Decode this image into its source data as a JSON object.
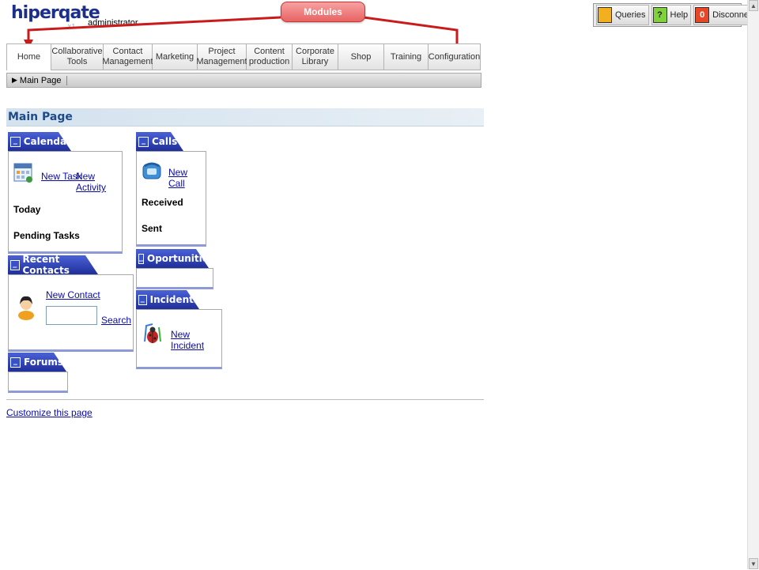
{
  "header": {
    "logo": "hiperqate",
    "logo_sub": "v.1",
    "user": "administrator",
    "callout": "Modules"
  },
  "topbar": [
    {
      "label": "Queries",
      "icon": "queries-icon",
      "color": "#f2b01e",
      "glyph": ""
    },
    {
      "label": "Help",
      "icon": "help-icon",
      "color": "#7fd23a",
      "glyph": "?"
    },
    {
      "label": "Disconnect",
      "icon": "disconnect-icon",
      "color": "#e84727",
      "glyph": "0"
    }
  ],
  "tabs": [
    {
      "line1": "Home",
      "line2": "",
      "active": true
    },
    {
      "line1": "Collaborative",
      "line2": "Tools"
    },
    {
      "line1": "Contact",
      "line2": "Management"
    },
    {
      "line1": "Marketing",
      "line2": ""
    },
    {
      "line1": "Project",
      "line2": "Management"
    },
    {
      "line1": "Content",
      "line2": "production"
    },
    {
      "line1": "Corporate",
      "line2": "Library"
    },
    {
      "line1": "Shop",
      "line2": ""
    },
    {
      "line1": "Training",
      "line2": ""
    },
    {
      "line1": "Configuration",
      "line2": ""
    }
  ],
  "breadcrumb": "Main Page",
  "page_title": "Main Page",
  "calendar": {
    "title": "Calendar",
    "new_task": "New Task",
    "new_activity": "New Activity",
    "today": "Today",
    "pending": "Pending Tasks"
  },
  "recent_contacts": {
    "title": "Recent Contacts",
    "new_contact": "New Contact",
    "search_value": "",
    "search": "Search"
  },
  "forums": {
    "title": "Forums"
  },
  "calls": {
    "title": "Calls",
    "new_call": "New Call",
    "received": "Received",
    "sent": "Sent"
  },
  "opportunities": {
    "title": "Oportunities"
  },
  "incidents": {
    "title": "Incidents",
    "new_incident": "New Incident"
  },
  "customize": "Customize this page",
  "colors": {
    "portlet_header": "#2a3db4",
    "title_bar": "#d3e2ee",
    "callout": "#e86464",
    "link": "#0b0ba8"
  }
}
